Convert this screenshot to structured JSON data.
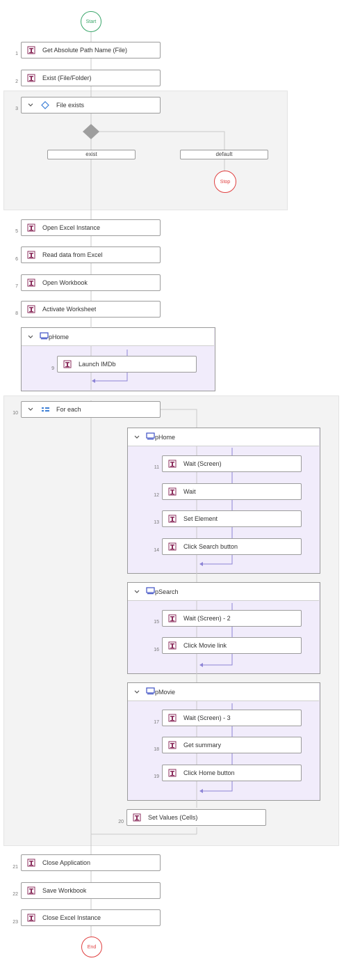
{
  "flow": {
    "start_label": "Start",
    "end_label": "End",
    "stop_label": "Stop",
    "steps": [
      {
        "num": "1",
        "label": "Get Absolute Path Name (File)"
      },
      {
        "num": "2",
        "label": "Exist (File/Folder)"
      },
      {
        "num": "3",
        "label": "File exists"
      },
      {
        "num": "5",
        "label": "Open Excel Instance"
      },
      {
        "num": "6",
        "label": "Read data from Excel"
      },
      {
        "num": "7",
        "label": "Open Workbook"
      },
      {
        "num": "8",
        "label": "Activate Worksheet"
      },
      {
        "num": "9",
        "label": "Launch IMDb"
      },
      {
        "num": "10",
        "label": "For each"
      },
      {
        "num": "11",
        "label": "Wait (Screen)"
      },
      {
        "num": "12",
        "label": "Wait"
      },
      {
        "num": "13",
        "label": "Set Element"
      },
      {
        "num": "14",
        "label": "Click Search button"
      },
      {
        "num": "15",
        "label": "Wait (Screen) - 2"
      },
      {
        "num": "16",
        "label": "Click Movie link"
      },
      {
        "num": "17",
        "label": "Wait (Screen) - 3"
      },
      {
        "num": "18",
        "label": "Get summary"
      },
      {
        "num": "19",
        "label": "Click Home button"
      },
      {
        "num": "20",
        "label": "Set Values (Cells)"
      },
      {
        "num": "21",
        "label": "Close Application"
      },
      {
        "num": "22",
        "label": "Save Workbook"
      },
      {
        "num": "23",
        "label": "Close Excel Instance"
      }
    ],
    "branches": {
      "exist": "exist",
      "default": "default"
    },
    "screens": {
      "phome_1": "pHome",
      "phome_2": "pHome",
      "psearch": "pSearch",
      "pmovie": "pMovie"
    }
  },
  "colors": {
    "action_icon": "#8b2d5c",
    "screen_icon": "#3d4fc4",
    "start": "#3aa66a",
    "end": "#e04040",
    "connector": "#c9c9c9",
    "loop_arrow": "#7a6fd0"
  }
}
